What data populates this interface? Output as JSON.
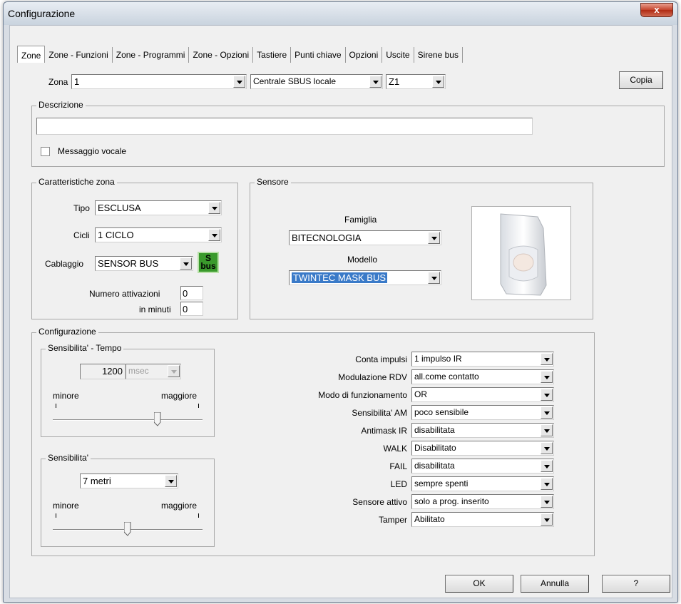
{
  "window": {
    "title": "Configurazione",
    "close_glyph": "x"
  },
  "tabs": [
    {
      "label": "Zone",
      "active": true
    },
    {
      "label": "Zone - Funzioni"
    },
    {
      "label": "Zone - Programmi"
    },
    {
      "label": "Zone - Opzioni"
    },
    {
      "label": "Tastiere"
    },
    {
      "label": "Punti chiave"
    },
    {
      "label": "Opzioni"
    },
    {
      "label": "Uscite"
    },
    {
      "label": "Sirene bus"
    }
  ],
  "top": {
    "zona_label": "Zona",
    "zona_value": "1",
    "centrale_value": "Centrale SBUS locale",
    "zone_code_value": "Z1",
    "copia_label": "Copia"
  },
  "descrizione": {
    "title": "Descrizione",
    "value": "",
    "messaggio_vocale_label": "Messaggio vocale",
    "messaggio_vocale_checked": false
  },
  "caratteristiche": {
    "title": "Caratteristiche zona",
    "tipo_label": "Tipo",
    "tipo_value": "ESCLUSA",
    "cicli_label": "Cicli",
    "cicli_value": "1  CICLO",
    "cablaggio_label": "Cablaggio",
    "cablaggio_value": "SENSOR BUS",
    "sbus_icon_top": "S",
    "sbus_icon_bottom": "bus",
    "numero_attivazioni_label": "Numero attivazioni",
    "numero_attivazioni_value": "0",
    "in_minuti_label": "in minuti",
    "in_minuti_value": "0"
  },
  "sensore": {
    "title": "Sensore",
    "famiglia_label": "Famiglia",
    "famiglia_value": "BITECNOLOGIA",
    "modello_label": "Modello",
    "modello_value": "TWINTEC MASK BUS"
  },
  "configurazione": {
    "title": "Configurazione",
    "sens_tempo": {
      "title": "Sensibilita' - Tempo",
      "value": "1200",
      "unit": "msec",
      "min_label": "minore",
      "max_label": "maggiore",
      "level": 0.7
    },
    "sensibilita": {
      "title": "Sensibilita'",
      "value": "7 metri",
      "min_label": "minore",
      "max_label": "maggiore",
      "level": 0.5
    },
    "options": [
      {
        "label": "Conta impulsi",
        "value": "1 impulso IR"
      },
      {
        "label": "Modulazione RDV",
        "value": "all.come contatto"
      },
      {
        "label": "Modo di funzionamento",
        "value": "OR"
      },
      {
        "label": "Sensibilita' AM",
        "value": "poco sensibile"
      },
      {
        "label": "Antimask IR",
        "value": "disabilitata"
      },
      {
        "label": "WALK",
        "value": "Disabilitato"
      },
      {
        "label": "FAIL",
        "value": "disabilitata"
      },
      {
        "label": "LED",
        "value": "sempre spenti"
      },
      {
        "label": "Sensore attivo",
        "value": "solo a prog. inserito"
      },
      {
        "label": "Tamper",
        "value": "Abilitato"
      }
    ]
  },
  "footer": {
    "ok_label": "OK",
    "annulla_label": "Annulla",
    "help_label": "?"
  }
}
